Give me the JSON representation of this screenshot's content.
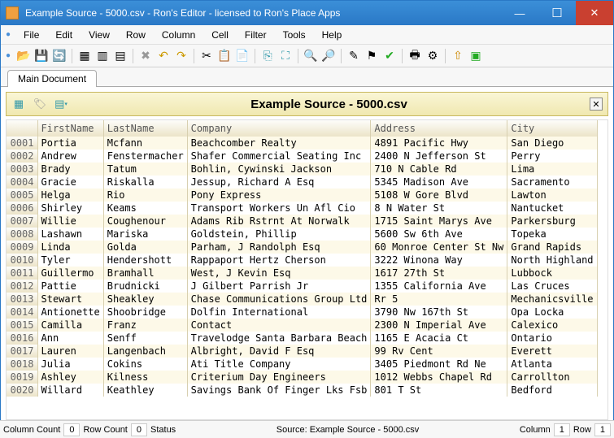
{
  "window": {
    "title": "Example Source - 5000.csv - Ron's Editor - licensed to Ron's Place Apps"
  },
  "menu": {
    "items": [
      "File",
      "Edit",
      "View",
      "Row",
      "Column",
      "Cell",
      "Filter",
      "Tools",
      "Help"
    ]
  },
  "tab": {
    "label": "Main Document"
  },
  "banner": {
    "title": "Example Source - 5000.csv"
  },
  "columns": [
    "FirstName",
    "LastName",
    "Company",
    "Address",
    "City"
  ],
  "rows": [
    {
      "n": "0001",
      "f": "Portia",
      "l": "Mcfann",
      "c": "Beachcomber Realty",
      "a": "4891 Pacific Hwy",
      "ci": "San Diego"
    },
    {
      "n": "0002",
      "f": "Andrew",
      "l": "Fenstermacher",
      "c": "Shafer Commercial Seating Inc",
      "a": "2400 N Jefferson St",
      "ci": "Perry"
    },
    {
      "n": "0003",
      "f": "Brady",
      "l": "Tatum",
      "c": "Bohlin, Cywinski Jackson",
      "a": "710 N Cable Rd",
      "ci": "Lima"
    },
    {
      "n": "0004",
      "f": "Gracie",
      "l": "Riskalla",
      "c": "Jessup, Richard A Esq",
      "a": "5345 Madison Ave",
      "ci": "Sacramento"
    },
    {
      "n": "0005",
      "f": "Helga",
      "l": "Rio",
      "c": "Pony Express",
      "a": "5108 W Gore Blvd",
      "ci": "Lawton"
    },
    {
      "n": "0006",
      "f": "Shirley",
      "l": "Keams",
      "c": "Transport Workers Un Afl Cio",
      "a": "8 N Water St",
      "ci": "Nantucket"
    },
    {
      "n": "0007",
      "f": "Willie",
      "l": "Coughenour",
      "c": "Adams Rib Rstrnt At Norwalk",
      "a": "1715 Saint Marys Ave",
      "ci": "Parkersburg"
    },
    {
      "n": "0008",
      "f": "Lashawn",
      "l": "Mariska",
      "c": "Goldstein, Phillip",
      "a": "5600 Sw 6th Ave",
      "ci": "Topeka"
    },
    {
      "n": "0009",
      "f": "Linda",
      "l": "Golda",
      "c": "Parham, J Randolph Esq",
      "a": "60 Monroe Center St Nw",
      "ci": "Grand Rapids"
    },
    {
      "n": "0010",
      "f": "Tyler",
      "l": "Hendershott",
      "c": "Rappaport Hertz Cherson",
      "a": "3222 Winona Way",
      "ci": "North Highland"
    },
    {
      "n": "0011",
      "f": "Guillermo",
      "l": "Bramhall",
      "c": "West, J Kevin Esq",
      "a": "1617 27th St",
      "ci": "Lubbock"
    },
    {
      "n": "0012",
      "f": "Pattie",
      "l": "Brudnicki",
      "c": "J Gilbert Parrish Jr",
      "a": "1355 California Ave",
      "ci": "Las Cruces"
    },
    {
      "n": "0013",
      "f": "Stewart",
      "l": "Sheakley",
      "c": "Chase Communications Group Ltd",
      "a": "Rr 5",
      "ci": "Mechanicsville"
    },
    {
      "n": "0014",
      "f": "Antionette",
      "l": "Shoobridge",
      "c": "Dolfin International",
      "a": "3790 Nw 167th St",
      "ci": "Opa Locka"
    },
    {
      "n": "0015",
      "f": "Camilla",
      "l": "Franz",
      "c": "Contact",
      "a": "2300 N Imperial Ave",
      "ci": "Calexico"
    },
    {
      "n": "0016",
      "f": "Ann",
      "l": "Senff",
      "c": "Travelodge Santa Barbara Beach",
      "a": "1165 E Acacia Ct",
      "ci": "Ontario"
    },
    {
      "n": "0017",
      "f": "Lauren",
      "l": "Langenbach",
      "c": "Albright, David F Esq",
      "a": "99 Rv Cent",
      "ci": "Everett"
    },
    {
      "n": "0018",
      "f": "Julia",
      "l": "Cokins",
      "c": "Ati Title Company",
      "a": "3405 Piedmont Rd Ne",
      "ci": "Atlanta"
    },
    {
      "n": "0019",
      "f": "Ashley",
      "l": "Kilness",
      "c": "Criterium Day Engineers",
      "a": "1012 Webbs Chapel Rd",
      "ci": "Carrollton"
    },
    {
      "n": "0020",
      "f": "Willard",
      "l": "Keathley",
      "c": "Savings Bank Of Finger Lks Fsb",
      "a": "801 T St",
      "ci": "Bedford"
    }
  ],
  "status": {
    "colcount_label": "Column Count",
    "colcount": "0",
    "rowcount_label": "Row Count",
    "rowcount": "0",
    "status_label": "Status",
    "source": "Source: Example Source - 5000.csv",
    "col_label": "Column",
    "col": "1",
    "row_label": "Row",
    "row": "1"
  }
}
